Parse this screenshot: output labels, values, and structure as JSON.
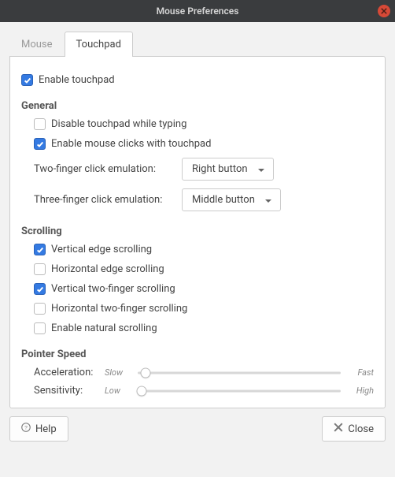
{
  "title": "Mouse Preferences",
  "tabs": {
    "mouse": "Mouse",
    "touchpad": "Touchpad"
  },
  "enable_touchpad": {
    "label": "Enable touchpad",
    "checked": true
  },
  "sections": {
    "general": {
      "title": "General",
      "disable_while_typing": {
        "label": "Disable touchpad while typing",
        "checked": false
      },
      "enable_clicks": {
        "label": "Enable mouse clicks with touchpad",
        "checked": true
      },
      "two_finger": {
        "label": "Two-finger click emulation:",
        "value": "Right button"
      },
      "three_finger": {
        "label": "Three-finger click emulation:",
        "value": "Middle button"
      }
    },
    "scrolling": {
      "title": "Scrolling",
      "vertical_edge": {
        "label": "Vertical edge scrolling",
        "checked": true
      },
      "horizontal_edge": {
        "label": "Horizontal edge scrolling",
        "checked": false
      },
      "vertical_twofinger": {
        "label": "Vertical two-finger scrolling",
        "checked": true
      },
      "horizontal_twofinger": {
        "label": "Horizontal two-finger scrolling",
        "checked": false
      },
      "natural": {
        "label": "Enable natural scrolling",
        "checked": false
      }
    },
    "pointer": {
      "title": "Pointer Speed",
      "acceleration": {
        "label": "Acceleration:",
        "low": "Slow",
        "high": "Fast",
        "value": 4
      },
      "sensitivity": {
        "label": "Sensitivity:",
        "low": "Low",
        "high": "High",
        "value": 2
      }
    }
  },
  "footer": {
    "help": "Help",
    "close": "Close"
  }
}
